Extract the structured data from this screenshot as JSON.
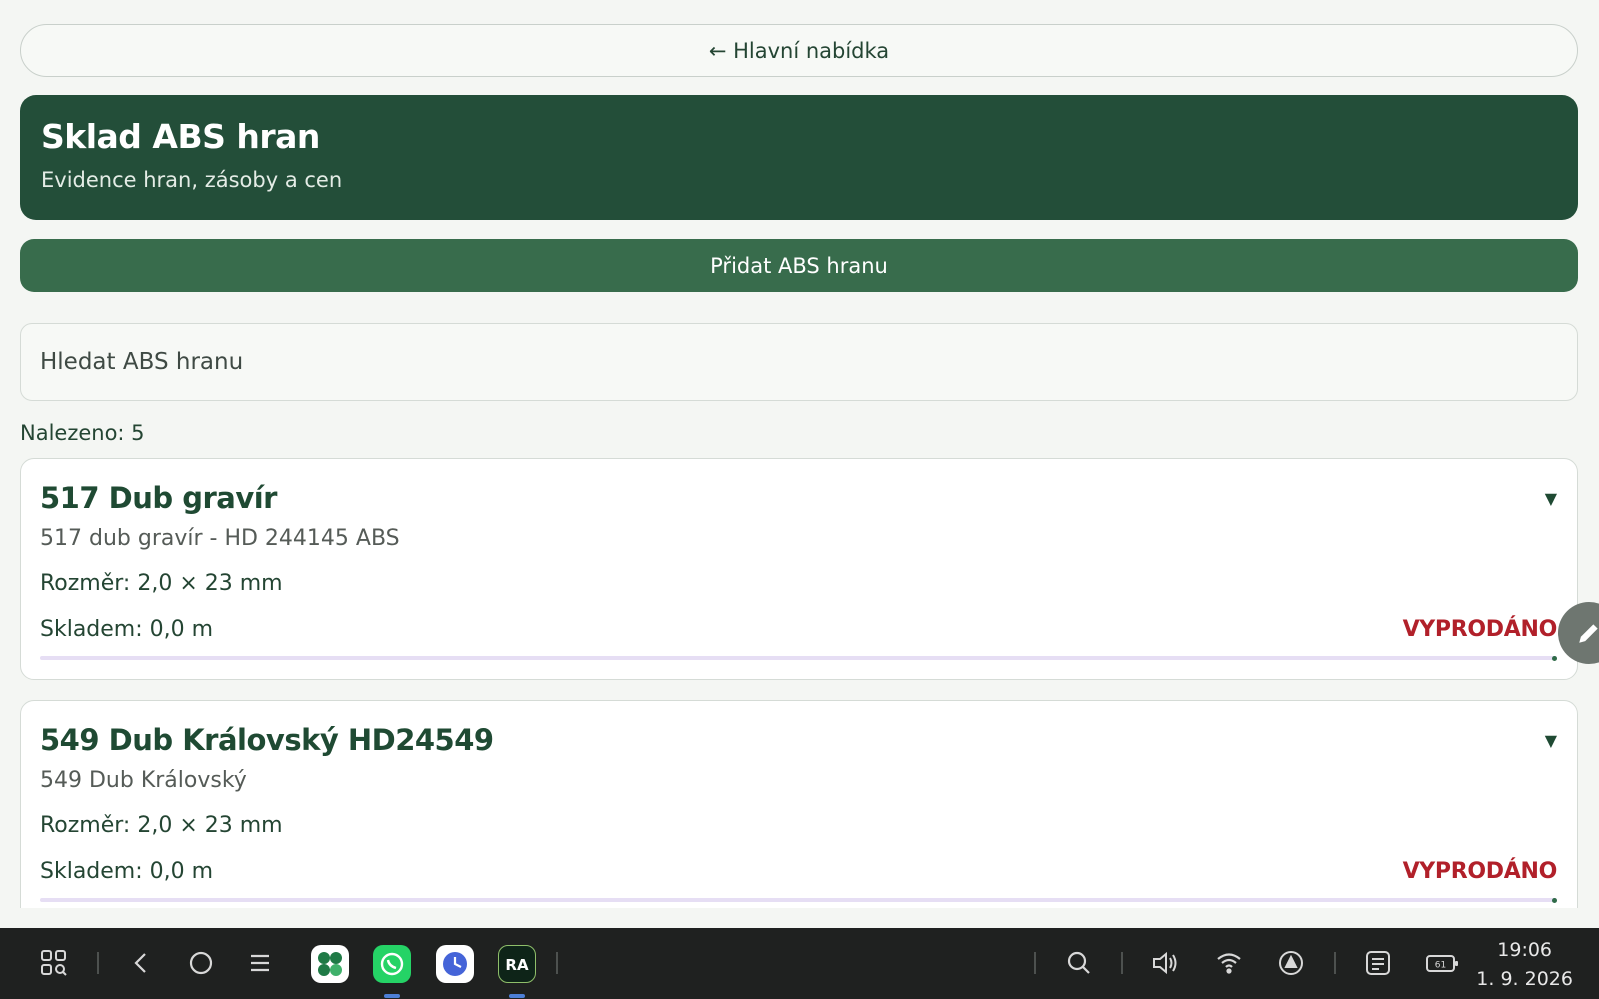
{
  "nav": {
    "back_label": "← Hlavní nabídka"
  },
  "header": {
    "title": "Sklad ABS hran",
    "subtitle": "Evidence hran, zásoby a cen"
  },
  "actions": {
    "add_label": "Přidat ABS hranu"
  },
  "search": {
    "placeholder": "Hledat ABS hranu",
    "value": ""
  },
  "results": {
    "found_text": "Nalezeno: 5"
  },
  "items": [
    {
      "title": "517 Dub gravír",
      "description": "517 dub gravír - HD 244145 ABS",
      "size": "Rozměr: 2,0 × 23 mm",
      "stock": "Skladem: 0,0 m",
      "status": "VYPRODÁNO",
      "chevron": "▼"
    },
    {
      "title": "549 Dub Královský HD24549",
      "description": "549 Dub Královský",
      "size": "Rozměr: 2,0 × 23 mm",
      "stock": "Skladem: 0,0 m",
      "status": "VYPRODÁNO",
      "chevron": "▼"
    }
  ],
  "colors": {
    "primary_dark": "#234e39",
    "primary": "#386c4c",
    "sold_out": "#b1202a",
    "background": "#f4f6f3"
  },
  "taskbar": {
    "time": "19:06",
    "date": "1. 9. 2026",
    "battery": "61",
    "icons": [
      "app-grid-icon",
      "back-icon",
      "home-icon",
      "recents-icon",
      "calculator-app-icon",
      "whatsapp-icon",
      "clock-app-icon",
      "ra-app-icon",
      "search-icon",
      "volume-icon",
      "wifi-icon",
      "navigation-icon",
      "notes-icon",
      "battery-icon"
    ]
  }
}
